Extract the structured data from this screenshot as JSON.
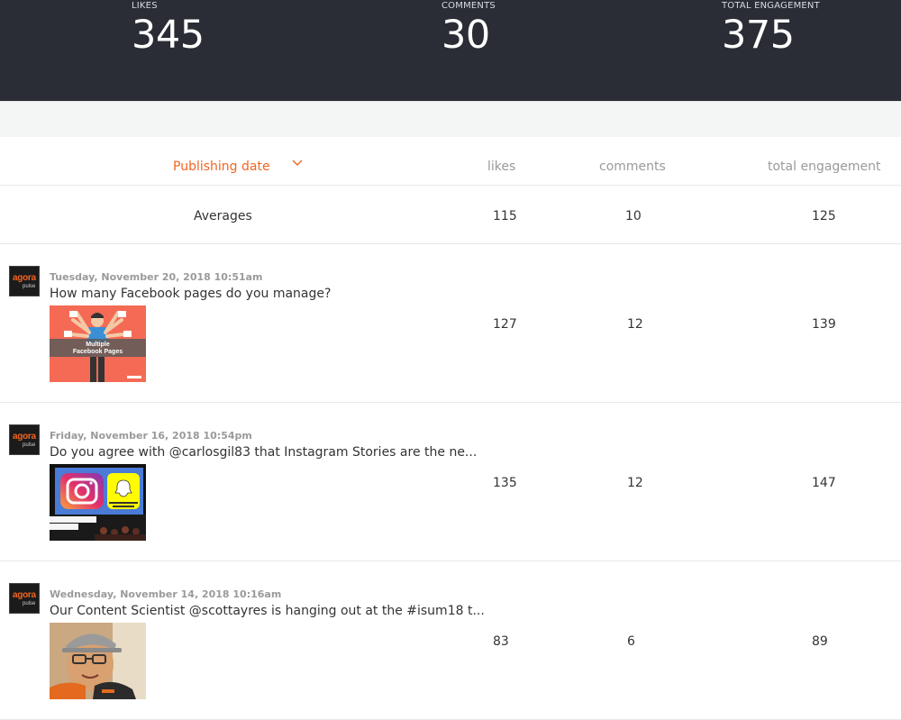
{
  "stats": {
    "likes_label": "LIKES",
    "likes_value": "345",
    "comments_label": "COMMENTS",
    "comments_value": "30",
    "total_label": "TOTAL ENGAGEMENT",
    "total_value": "375"
  },
  "table": {
    "headers": {
      "date": "Publishing date",
      "likes": "likes",
      "comments": "comments",
      "total": "total engagement"
    },
    "averages": {
      "label": "Averages",
      "likes": "115",
      "comments": "10",
      "total": "125"
    },
    "posts": [
      {
        "date": "Tuesday, November 20, 2018 10:51am",
        "text": "How many Facebook pages do you manage?",
        "likes": "127",
        "comments": "12",
        "total": "139",
        "thumb_caption_1": "Multiple",
        "thumb_caption_2": "Facebook Pages"
      },
      {
        "date": "Friday, November 16, 2018 10:54pm",
        "text": "Do you agree with @carlosgil83 that Instagram Stories are the ne...",
        "likes": "135",
        "comments": "12",
        "total": "147"
      },
      {
        "date": "Wednesday, November 14, 2018 10:16am",
        "text": "Our Content Scientist @scottayres is hanging out at the #isum18 t...",
        "likes": "83",
        "comments": "6",
        "total": "89"
      }
    ]
  },
  "brand": {
    "logo_top": "agora",
    "logo_bottom": "pulse",
    "accent": "#f26522",
    "header_bg": "#2a2d35"
  }
}
